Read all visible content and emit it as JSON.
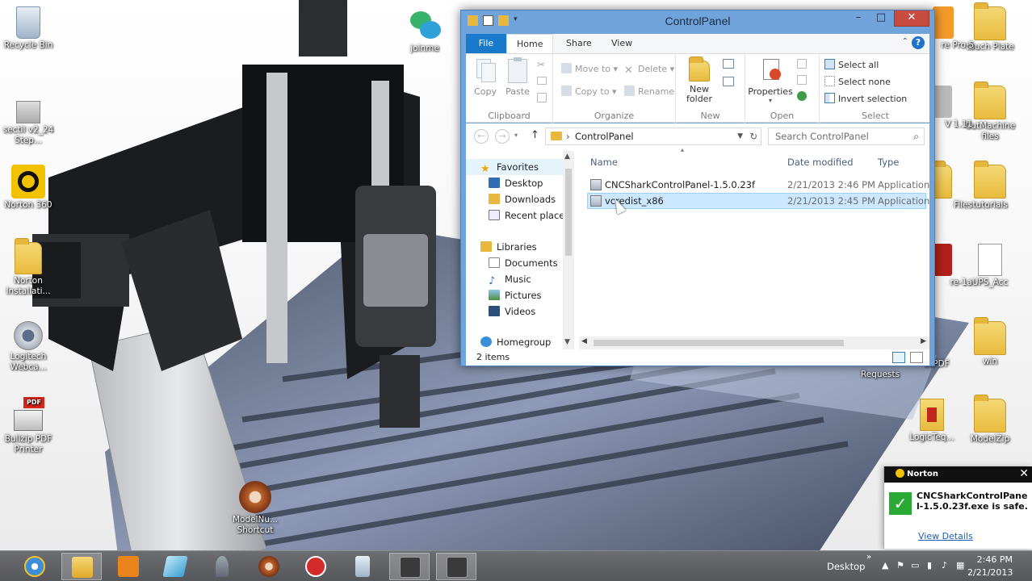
{
  "desktop": {
    "left_icons": [
      {
        "label": "Recycle Bin",
        "icon": "recycle-bin-icon"
      },
      {
        "label": "sectil v2_24 Step...",
        "icon": "installer-icon"
      },
      {
        "label": "Norton 360",
        "icon": "norton-360-icon"
      },
      {
        "label": "Norton Installati...",
        "icon": "norton-installer-icon"
      },
      {
        "label": "Logitech Webca...",
        "icon": "webcam-icon"
      },
      {
        "label": "Bullzip PDF Printer",
        "icon": "pdf-printer-icon"
      }
    ],
    "mid_icons": [
      {
        "label": "joinme",
        "icon": "joinme-icon"
      },
      {
        "label": "ModelNu... Shortcut",
        "icon": "modelnumber-shortcut-icon"
      }
    ],
    "right_icons": [
      {
        "label": "touch Plate",
        "icon": "folder-icon"
      },
      {
        "label": "CutMachine files",
        "icon": "folder-icon"
      },
      {
        "label": "tutorials",
        "icon": "folder-icon"
      },
      {
        "label": "UPS_Acc",
        "icon": "document-icon"
      },
      {
        "label": "win",
        "icon": "folder-icon"
      },
      {
        "label": "ModelZip",
        "icon": "folder-icon"
      }
    ],
    "partial_labels": {
      "pro": "re Pro 5",
      "v": "V 1.11",
      "files": "Files",
      "re1a": "re-1a",
      "requests": "Requests",
      "pdf": "ssPDF",
      "logic": "LogicTeq..."
    }
  },
  "window": {
    "title": "ControlPanel",
    "tabs": [
      "File",
      "Home",
      "Share",
      "View"
    ],
    "ribbon": {
      "clipboard": {
        "label": "Clipboard",
        "copy": "Copy",
        "paste": "Paste"
      },
      "organize": {
        "label": "Organize",
        "move_to": "Move to",
        "copy_to": "Copy to",
        "delete": "Delete",
        "rename": "Rename"
      },
      "new": {
        "label": "New",
        "new_folder_1": "New",
        "new_folder_2": "folder"
      },
      "open": {
        "label": "Open",
        "properties": "Properties"
      },
      "select": {
        "label": "Select",
        "select_all": "Select all",
        "select_none": "Select none",
        "invert": "Invert selection"
      }
    },
    "address": "ControlPanel",
    "search_placeholder": "Search ControlPanel",
    "nav_pane": {
      "favorites": "Favorites",
      "fav_items": [
        "Desktop",
        "Downloads",
        "Recent places"
      ],
      "libraries": "Libraries",
      "lib_items": [
        "Documents",
        "Music",
        "Pictures",
        "Videos"
      ],
      "homegroup": "Homegroup"
    },
    "columns": {
      "name": "Name",
      "date": "Date modified",
      "type": "Type"
    },
    "files": [
      {
        "name": "CNCSharkControlPanel-1.5.0.23f",
        "date": "2/21/2013 2:46 PM",
        "type": "Application"
      },
      {
        "name": "vcredist_x86",
        "date": "2/21/2013 2:45 PM",
        "type": "Application"
      }
    ],
    "status": "2 items"
  },
  "norton": {
    "brand": "Norton",
    "message": "CNCSharkControlPanel-1.5.0.23f.exe is safe.",
    "link": "View Details"
  },
  "taskbar": {
    "desktop_label": "Desktop",
    "time": "2:46 PM",
    "date": "2/21/2013"
  },
  "colors": {
    "window_frame": "#6fa3d9",
    "file_tab": "#1979ca",
    "selection": "#cce8ff",
    "norton_check": "#2aa935"
  }
}
